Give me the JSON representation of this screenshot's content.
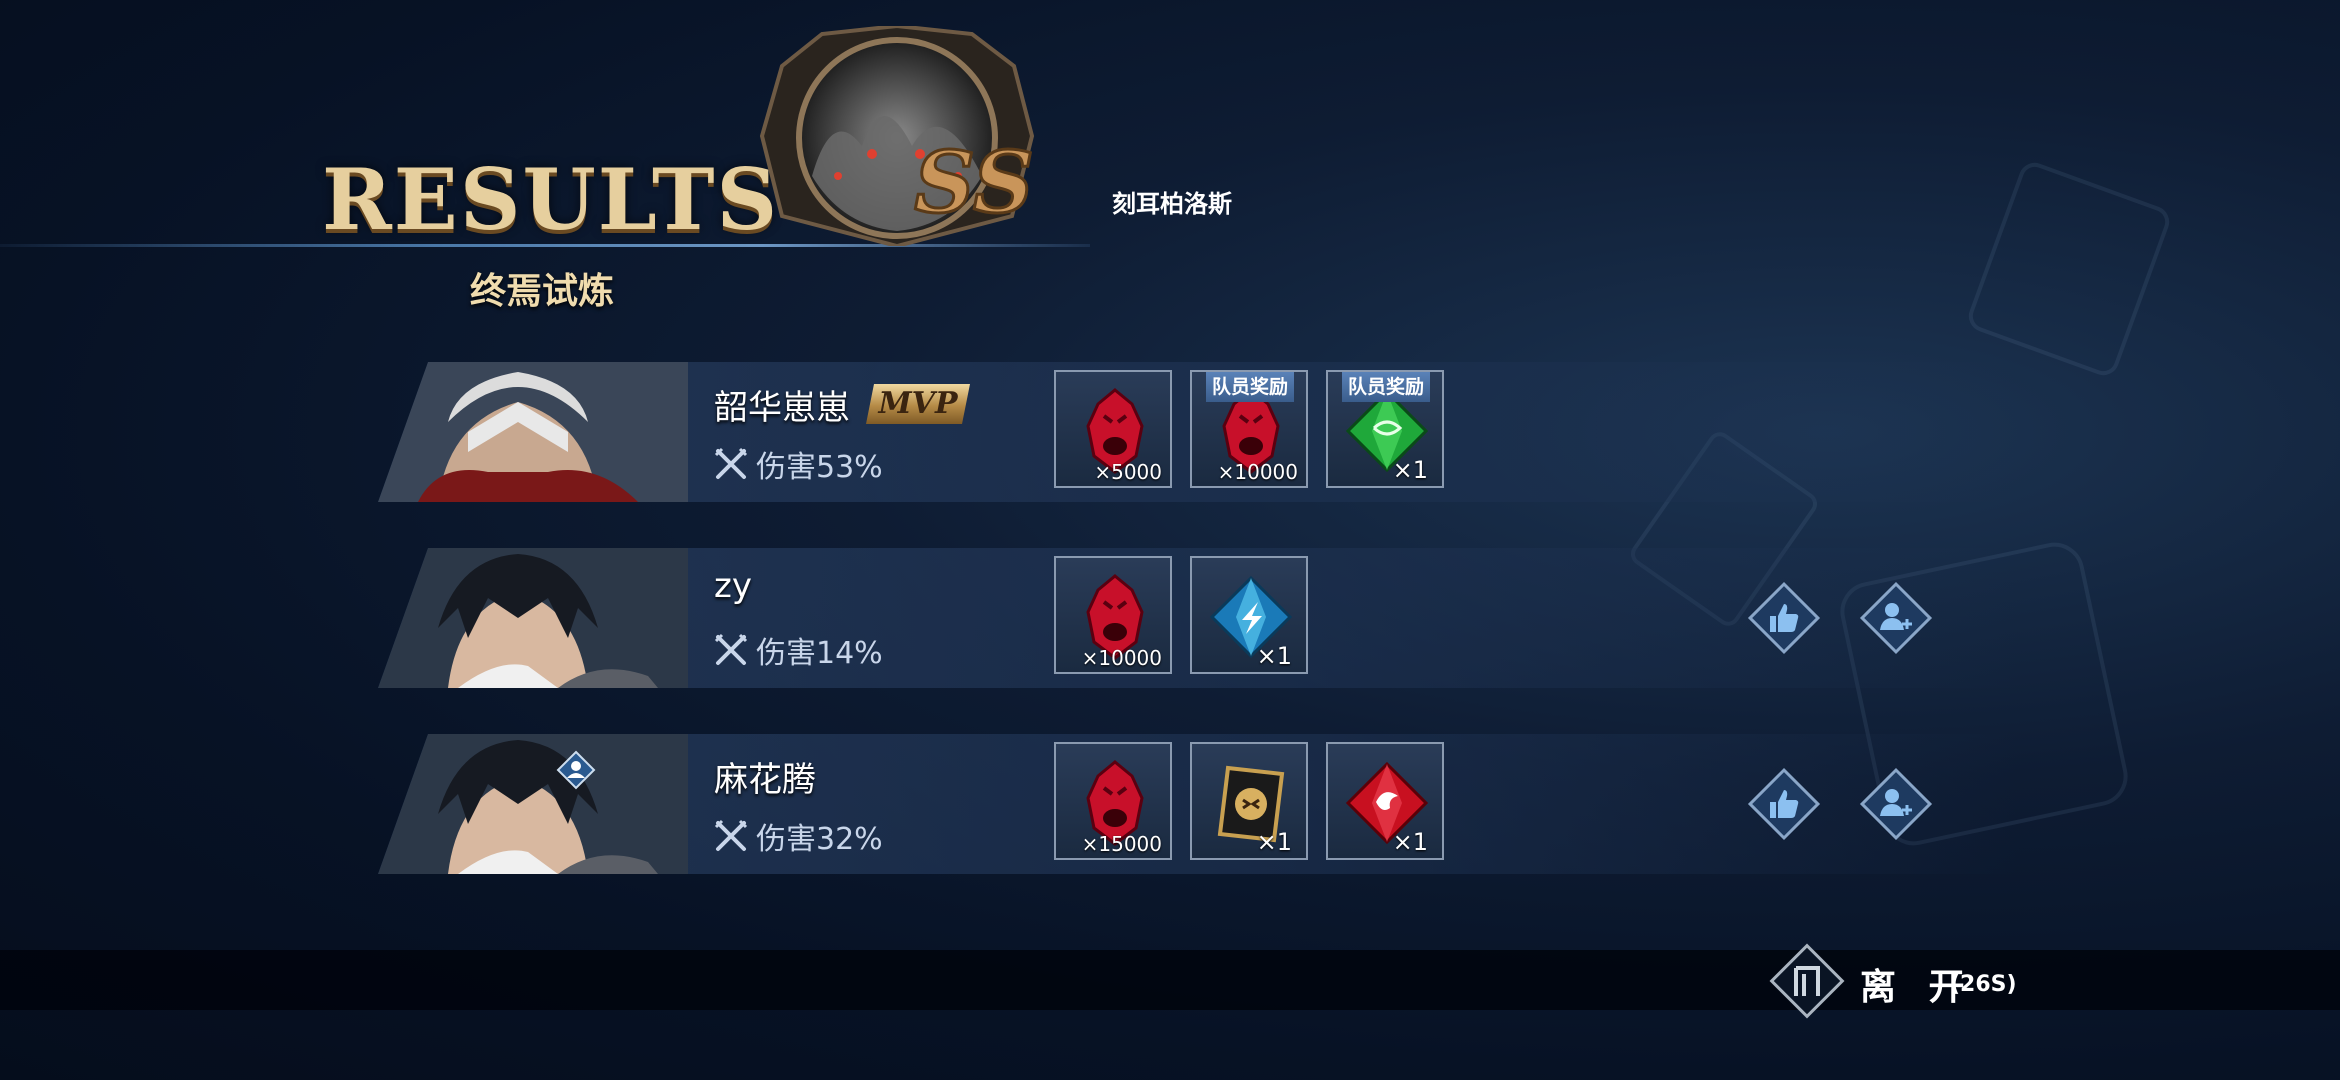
{
  "header": {
    "results_title": "RESULTS",
    "trial_name": "终焉试炼",
    "boss_name": "刻耳柏洛斯",
    "rank": "SS"
  },
  "players": [
    {
      "name": "韶华崽崽",
      "mvp": "MVP",
      "damage_label": "伤害53%",
      "rewards": [
        {
          "icon": "red-orb-icon",
          "quantity": "×5000",
          "team_tag": ""
        },
        {
          "icon": "red-orb-icon",
          "quantity": "×10000",
          "team_tag": "队员奖励"
        },
        {
          "icon": "green-gem-icon",
          "quantity": "×1",
          "team_tag": "队员奖励"
        }
      ]
    },
    {
      "name": "zy",
      "damage_label": "伤害14%",
      "rewards": [
        {
          "icon": "red-orb-icon",
          "quantity": "×10000"
        },
        {
          "icon": "blue-gem-icon",
          "quantity": "×1"
        }
      ]
    },
    {
      "name": "麻花腾",
      "damage_label": "伤害32%",
      "rewards": [
        {
          "icon": "red-orb-icon",
          "quantity": "×15000"
        },
        {
          "icon": "golden-card-icon",
          "quantity": "×1"
        },
        {
          "icon": "red-gem-icon",
          "quantity": "×1"
        }
      ]
    }
  ],
  "footer": {
    "leave_label": "离 开",
    "timer": "(26S)"
  },
  "colors": {
    "background": "#071225",
    "gold_title": "#e6cf9e",
    "row_band": "#283e60",
    "accent_blue": "#4a78a8"
  }
}
